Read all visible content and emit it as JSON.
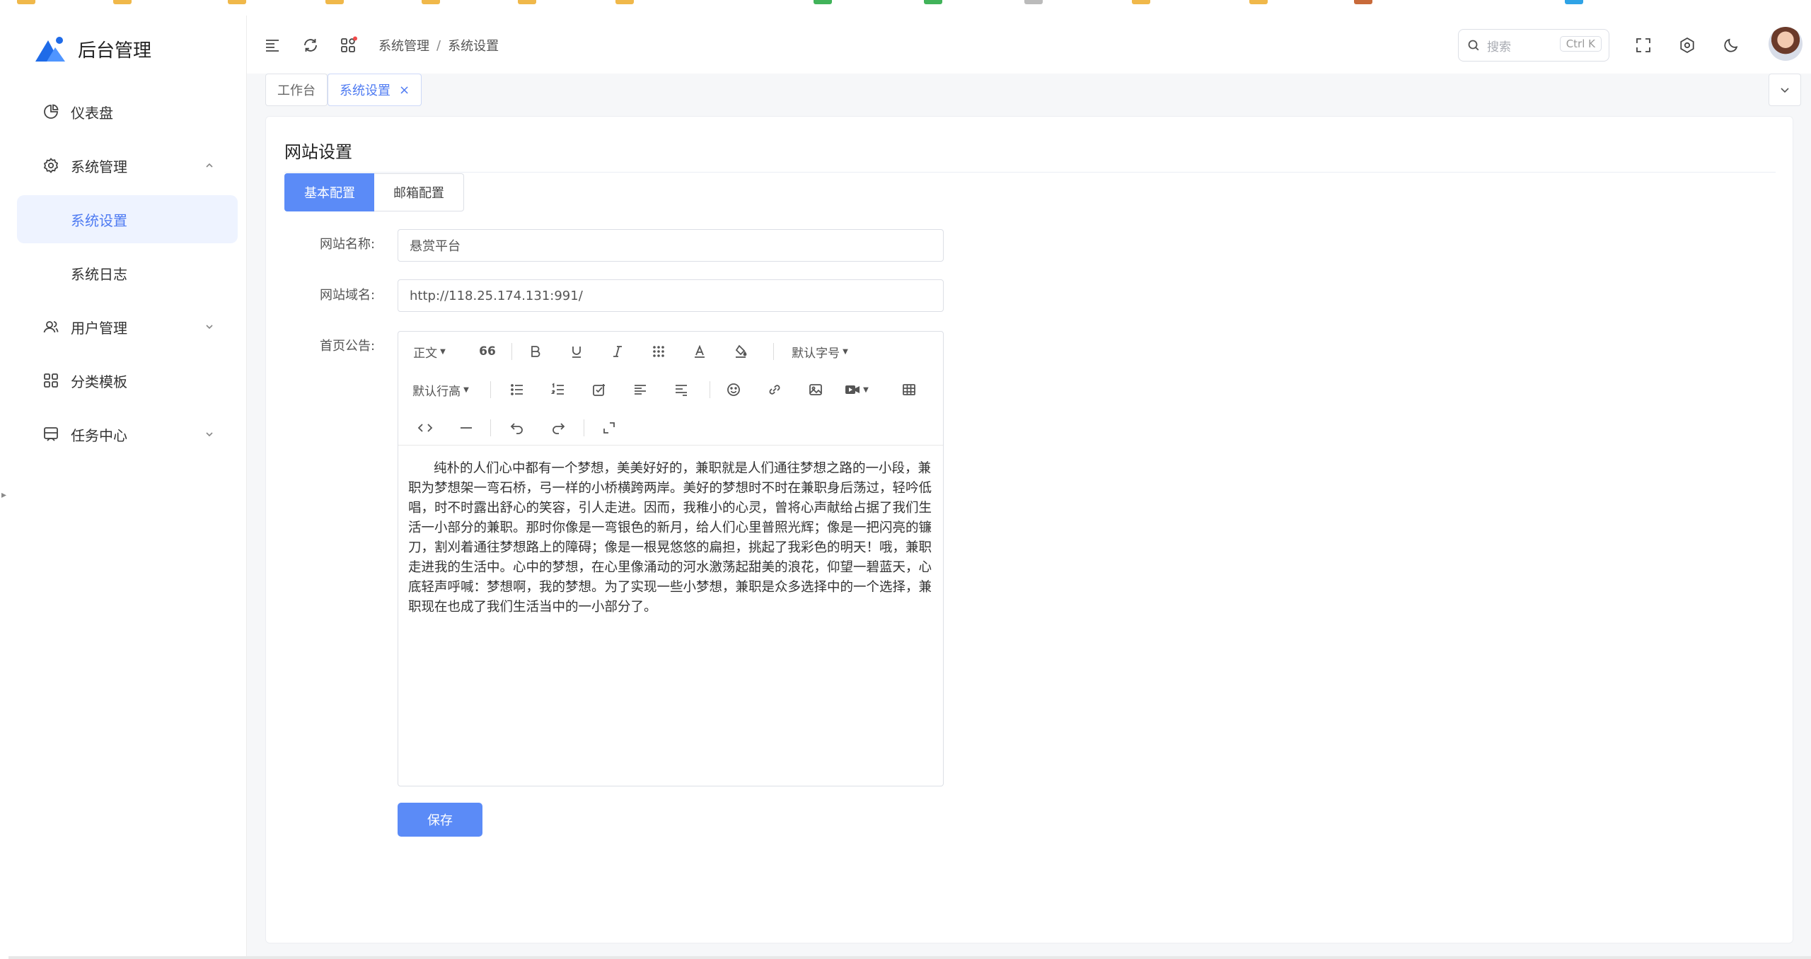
{
  "app": {
    "title": "后台管理"
  },
  "sidebar": {
    "items": [
      {
        "label": "仪表盘",
        "icon": "pie-chart-icon"
      },
      {
        "label": "系统管理",
        "icon": "gear-icon",
        "expanded": true
      },
      {
        "label": "系统设置",
        "active": true
      },
      {
        "label": "系统日志"
      },
      {
        "label": "用户管理",
        "icon": "users-icon"
      },
      {
        "label": "分类模板",
        "icon": "grid-icon"
      },
      {
        "label": "任务中心",
        "icon": "task-icon"
      }
    ]
  },
  "header": {
    "breadcrumb": [
      "系统管理",
      "系统设置"
    ],
    "breadcrumb_sep": "/",
    "search_placeholder": "搜索",
    "search_shortcut": "Ctrl K"
  },
  "tabs": [
    {
      "label": "工作台"
    },
    {
      "label": "系统设置",
      "active": true,
      "close": "×"
    }
  ],
  "page": {
    "title": "网站设置",
    "segments": [
      "基本配置",
      "邮箱配置"
    ],
    "fields": {
      "site_name_label": "网站名称:",
      "site_name_value": "悬赏平台",
      "site_domain_label": "网站域名:",
      "site_domain_value": "http://118.25.174.131:991/",
      "notice_label": "首页公告:"
    },
    "editor": {
      "heading_select": "正文",
      "font_size_select": "默认字号",
      "line_height_select": "默认行高",
      "quote_glyph": "66",
      "content": "纯朴的人们心中都有一个梦想，美美好好的，兼职就是人们通往梦想之路的一小段，兼职为梦想架一弯石桥，弓一样的小桥横跨两岸。美好的梦想时不时在兼职身后荡过，轻吟低唱，时不时露出舒心的笑容，引人走进。因而，我稚小的心灵，曾将心声献给占据了我们生活一小部分的兼职。那时你像是一弯银色的新月，给人们心里普照光辉；像是一把闪亮的镰刀，割刈着通往梦想路上的障碍；像是一根晃悠悠的扁担，挑起了我彩色的明天！哦，兼职走进我的生活中。心中的梦想，在心里像涌动的河水激荡起甜美的浪花，仰望一碧蓝天，心底轻声呼喊：梦想啊，我的梦想。为了实现一些小梦想，兼职是众多选择中的一个选择，兼职现在也成了我们生活当中的一小部分了。"
    },
    "save_label": "保存"
  },
  "colors": {
    "primary": "#5b8bf7",
    "active_text": "#4f7bf2",
    "badge": "#f04a4a"
  }
}
